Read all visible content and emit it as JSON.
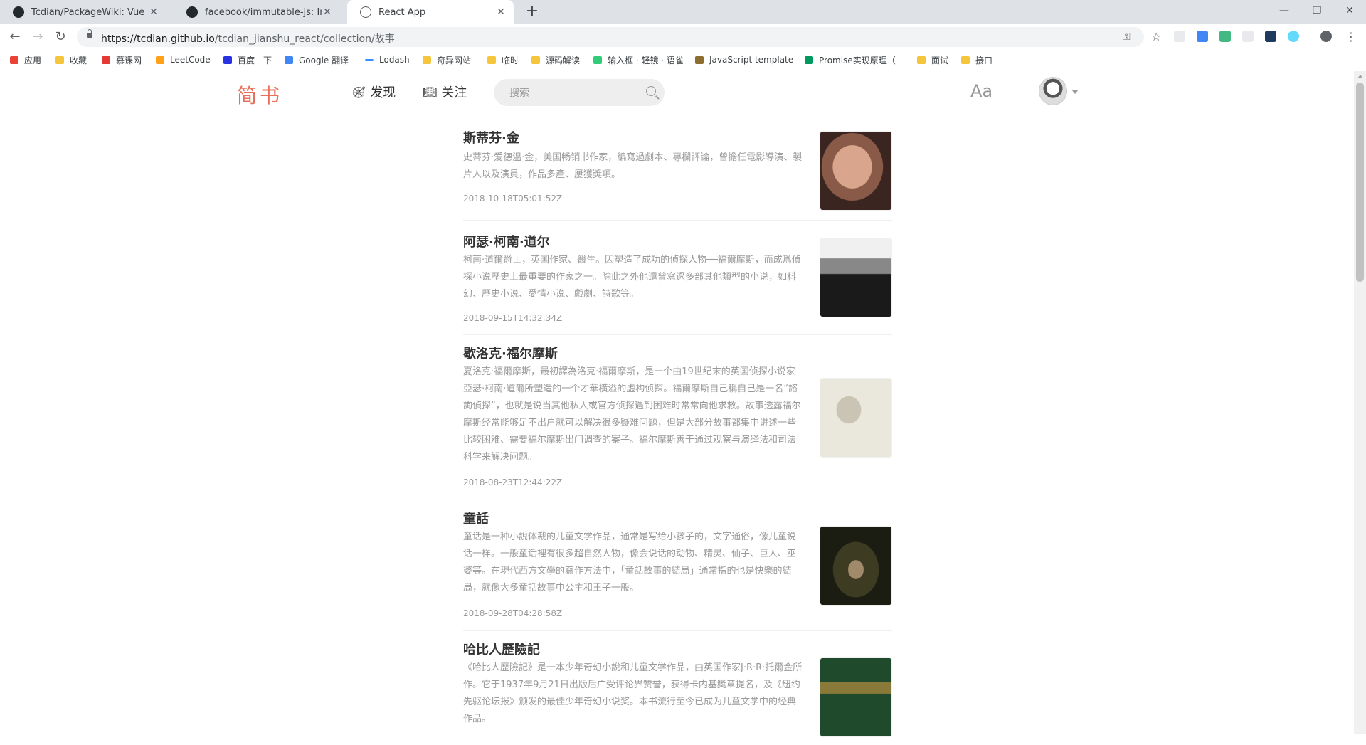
{
  "browser": {
    "tabs": [
      {
        "title": "Tcdian/PackageWiki: Vue Pack"
      },
      {
        "title": "facebook/immutable-js: Immu"
      },
      {
        "title": "React App"
      }
    ],
    "url_host": "https://tcdian.github.io",
    "url_path": "/tcdian_jianshu_react/collection/故事",
    "bookmarks": [
      {
        "label": "应用"
      },
      {
        "label": "收藏"
      },
      {
        "label": "慕课网"
      },
      {
        "label": "LeetCode"
      },
      {
        "label": "百度一下"
      },
      {
        "label": "Google 翻译"
      },
      {
        "label": "Lodash"
      },
      {
        "label": "奇异网站"
      },
      {
        "label": "临时"
      },
      {
        "label": "源码解读"
      },
      {
        "label": "输入框 · 轻镜 · 语雀"
      },
      {
        "label": "JavaScript template"
      },
      {
        "label": "Promise实现原理（"
      },
      {
        "label": "面试"
      },
      {
        "label": "接口"
      }
    ]
  },
  "header": {
    "logo": "简书",
    "nav": [
      {
        "label": "发现",
        "icon": "compass-icon"
      },
      {
        "label": "关注",
        "icon": "book-icon"
      }
    ],
    "search_placeholder": "搜索",
    "font_toggle": "Aa"
  },
  "articles": [
    {
      "title": "斯蒂芬·金",
      "abstract": "史蒂芬·爱德温·金，美国畅销书作家，編寫過劇本、專欄評論，曾擔任電影導演、製片人以及演員，作品多產、屢獲獎項。",
      "date": "2018-10-18T05:01:52Z"
    },
    {
      "title": "阿瑟·柯南·道尔",
      "abstract": "柯南·道爾爵士，英国作家、醫生。因塑造了成功的偵探人物──福爾摩斯，而成爲偵探小说歷史上最重要的作家之一。除此之外他還曾寫過多部其他類型的小说，如科幻、歷史小说、愛情小说、戲劇、詩歌等。",
      "date": "2018-09-15T14:32:34Z"
    },
    {
      "title": "歇洛克·福尔摩斯",
      "abstract": "夏洛克·福爾摩斯，最初譯為洛克·福爾摩斯，是一个由19世纪末的英国侦探小说家亞瑟·柯南·道爾所塑造的一个才華橫溢的虛构侦探。福爾摩斯自己稱自己是一名“諮詢偵探”，也就是说当其他私人或官方侦探遇到困难时常常向他求救。故事透露福尔摩斯经常能够足不出户就可以解决很多疑难问题，但是大部分故事都集中讲述一些比较困难、需要福尔摩斯出门调查的案子。福尔摩斯善于通过观察与演绎法和司法科学来解决问题。",
      "date": "2018-08-23T12:44:22Z"
    },
    {
      "title": "童話",
      "abstract": "童话是一种小說体裁的儿童文学作品，通常是写给小孩子的，文字通俗，像儿童说话一样。一般童话裡有很多超自然人物，像会说话的动物、精灵、仙子、巨人、巫婆等。在現代西方文學的寫作方法中，「童話故事的結局」通常指的也是快樂的結局，就像大多童話故事中公主和王子一般。",
      "date": "2018-09-28T04:28:58Z"
    },
    {
      "title": "哈比人歷險記",
      "abstract": "《哈比人歷險記》是一本少年奇幻小說和儿童文学作品，由英国作家J·R·R·托爾金所作。它于1937年9月21日出版后广受评论界赞誉，获得卡内基獎章提名，及《纽约先驱论坛报》颁发的最佳少年奇幻小说奖。本书流行至今已成为儿童文学中的经典作品。",
      "date": ""
    }
  ]
}
